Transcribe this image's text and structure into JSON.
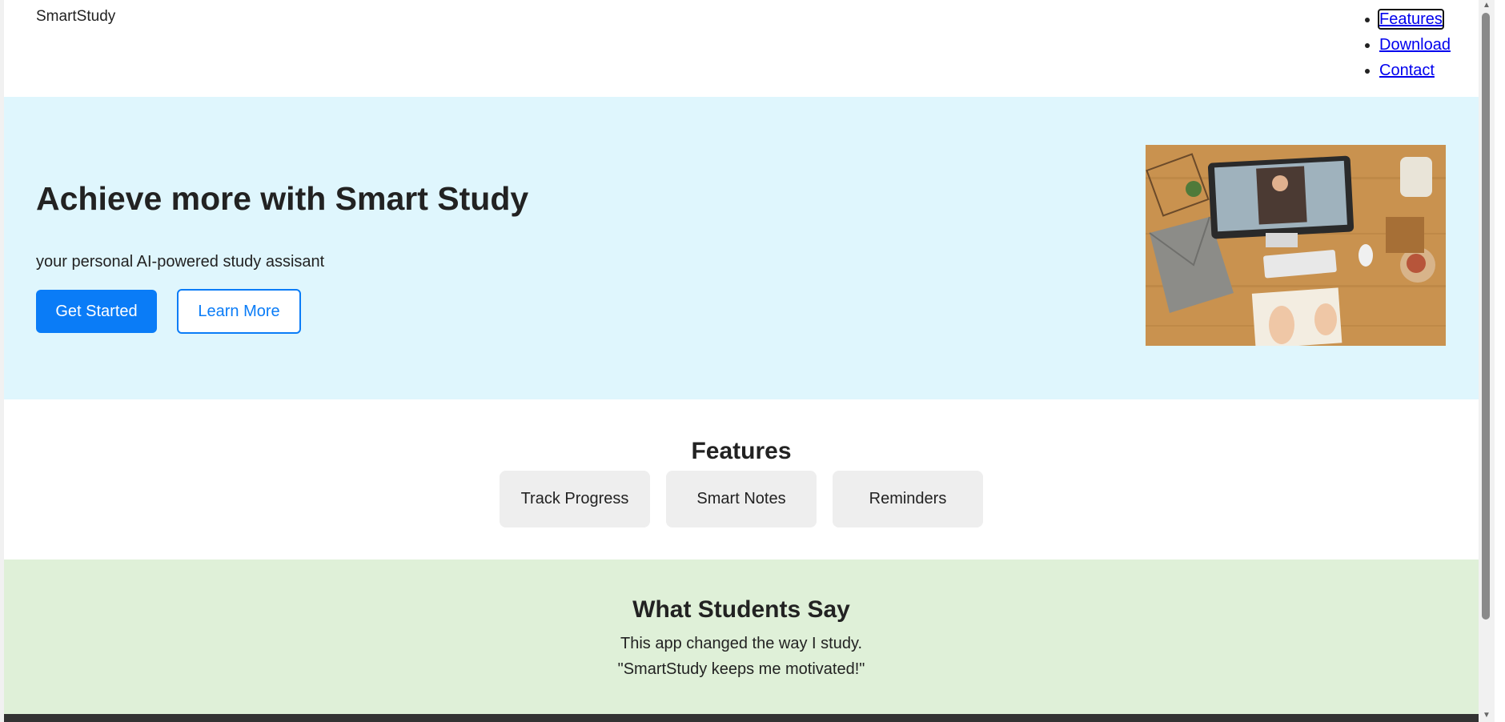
{
  "header": {
    "logo": "SmartStudy",
    "nav": [
      {
        "label": "Features"
      },
      {
        "label": "Download"
      },
      {
        "label": "Contact"
      }
    ]
  },
  "hero": {
    "title": "Achieve more with Smart Study",
    "subtitle": "your personal AI-powered study assisant",
    "primary_button": "Get Started",
    "secondary_button": "Learn More",
    "image_icon": "desk-photo-icon"
  },
  "features": {
    "heading": "Features",
    "cards": [
      {
        "label": "Track Progress"
      },
      {
        "label": "Smart Notes"
      },
      {
        "label": "Reminders"
      }
    ]
  },
  "testimonials": {
    "heading": "What Students Say",
    "quotes": [
      "This app changed the way I study.",
      "\"SmartStudy keeps me motivated!\""
    ]
  },
  "colors": {
    "accent": "#0a7cf7",
    "hero_bg": "#dff6fd",
    "testimonials_bg": "#dff0d8",
    "card_bg": "#eeeeee",
    "link": "#0000ee"
  }
}
